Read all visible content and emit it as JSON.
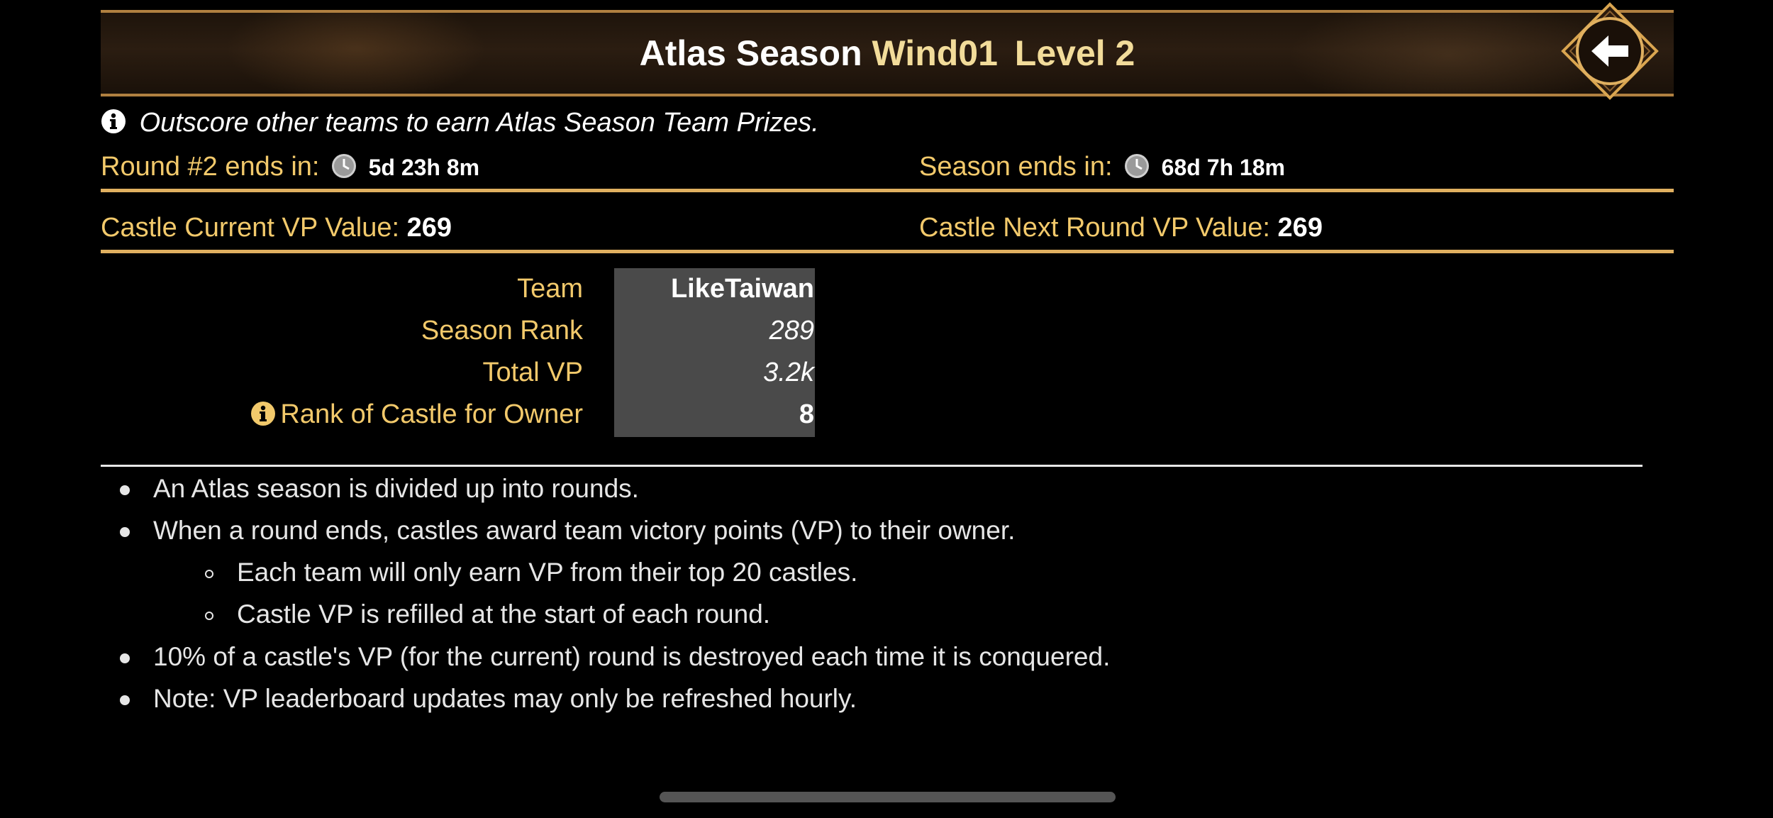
{
  "header": {
    "title_main": "Atlas Season",
    "title_season": "Wind01",
    "title_level": "Level 2",
    "back_icon": "arrow-left-icon"
  },
  "info": {
    "icon": "info-circle-icon",
    "text": "Outscore other teams to earn Atlas Season Team Prizes."
  },
  "timers": {
    "round_label": "Round #2 ends in:",
    "round_value": "5d 23h 8m",
    "season_label": "Season ends in:",
    "season_value": "68d 7h 18m",
    "clock_icon": "clock-icon"
  },
  "vp": {
    "current_label": "Castle Current VP Value:",
    "current_value": "269",
    "next_label": "Castle Next Round VP Value:",
    "next_value": "269"
  },
  "stats": {
    "team_label": "Team",
    "team_value": "LikeTaiwan",
    "rank_label": "Season Rank",
    "rank_value": "289",
    "total_label": "Total VP",
    "total_value": "3.2k",
    "owner_rank_label": "Rank of Castle for Owner",
    "owner_rank_value": "8"
  },
  "bullets": [
    "An Atlas season is divided up into rounds.",
    "When a round ends, castles award team victory points (VP) to their owner.",
    "Each team will only earn VP from their top 20 castles.",
    "Castle VP is refilled at the start of each round.",
    "10% of a castle's VP (for the current) round is destroyed each time it is conquered.",
    "Note: VP leaderboard updates may only be refreshed hourly."
  ],
  "colors": {
    "gold_label": "#f2c96b",
    "gold_title": "#f2dc9a",
    "rule": "#e0b060",
    "stat_box": "#4a4a4a"
  }
}
